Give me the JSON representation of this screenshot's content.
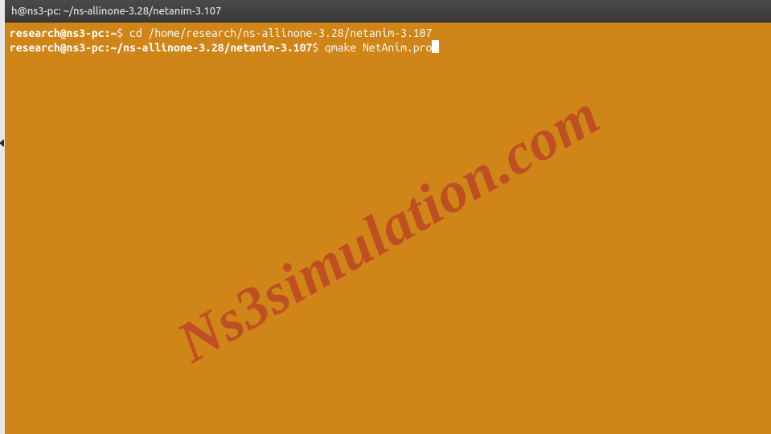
{
  "titlebar": {
    "title": "h@ns3-pc: ~/ns-allinone-3.28/netanim-3.107"
  },
  "terminal": {
    "lines": [
      {
        "prompt_user": "research@ns3-pc:",
        "prompt_path": "~",
        "prompt_dollar": "$ ",
        "command": "cd /home/research/ns-allinone-3.28/netanim-3.107"
      },
      {
        "prompt_user": "research@ns3-pc:",
        "prompt_path": "~/ns-allinone-3.28/netanim-3.107",
        "prompt_dollar": "$ ",
        "command": "qmake NetAnim.pro"
      }
    ]
  },
  "watermark": {
    "text": "Ns3simulation.com"
  }
}
